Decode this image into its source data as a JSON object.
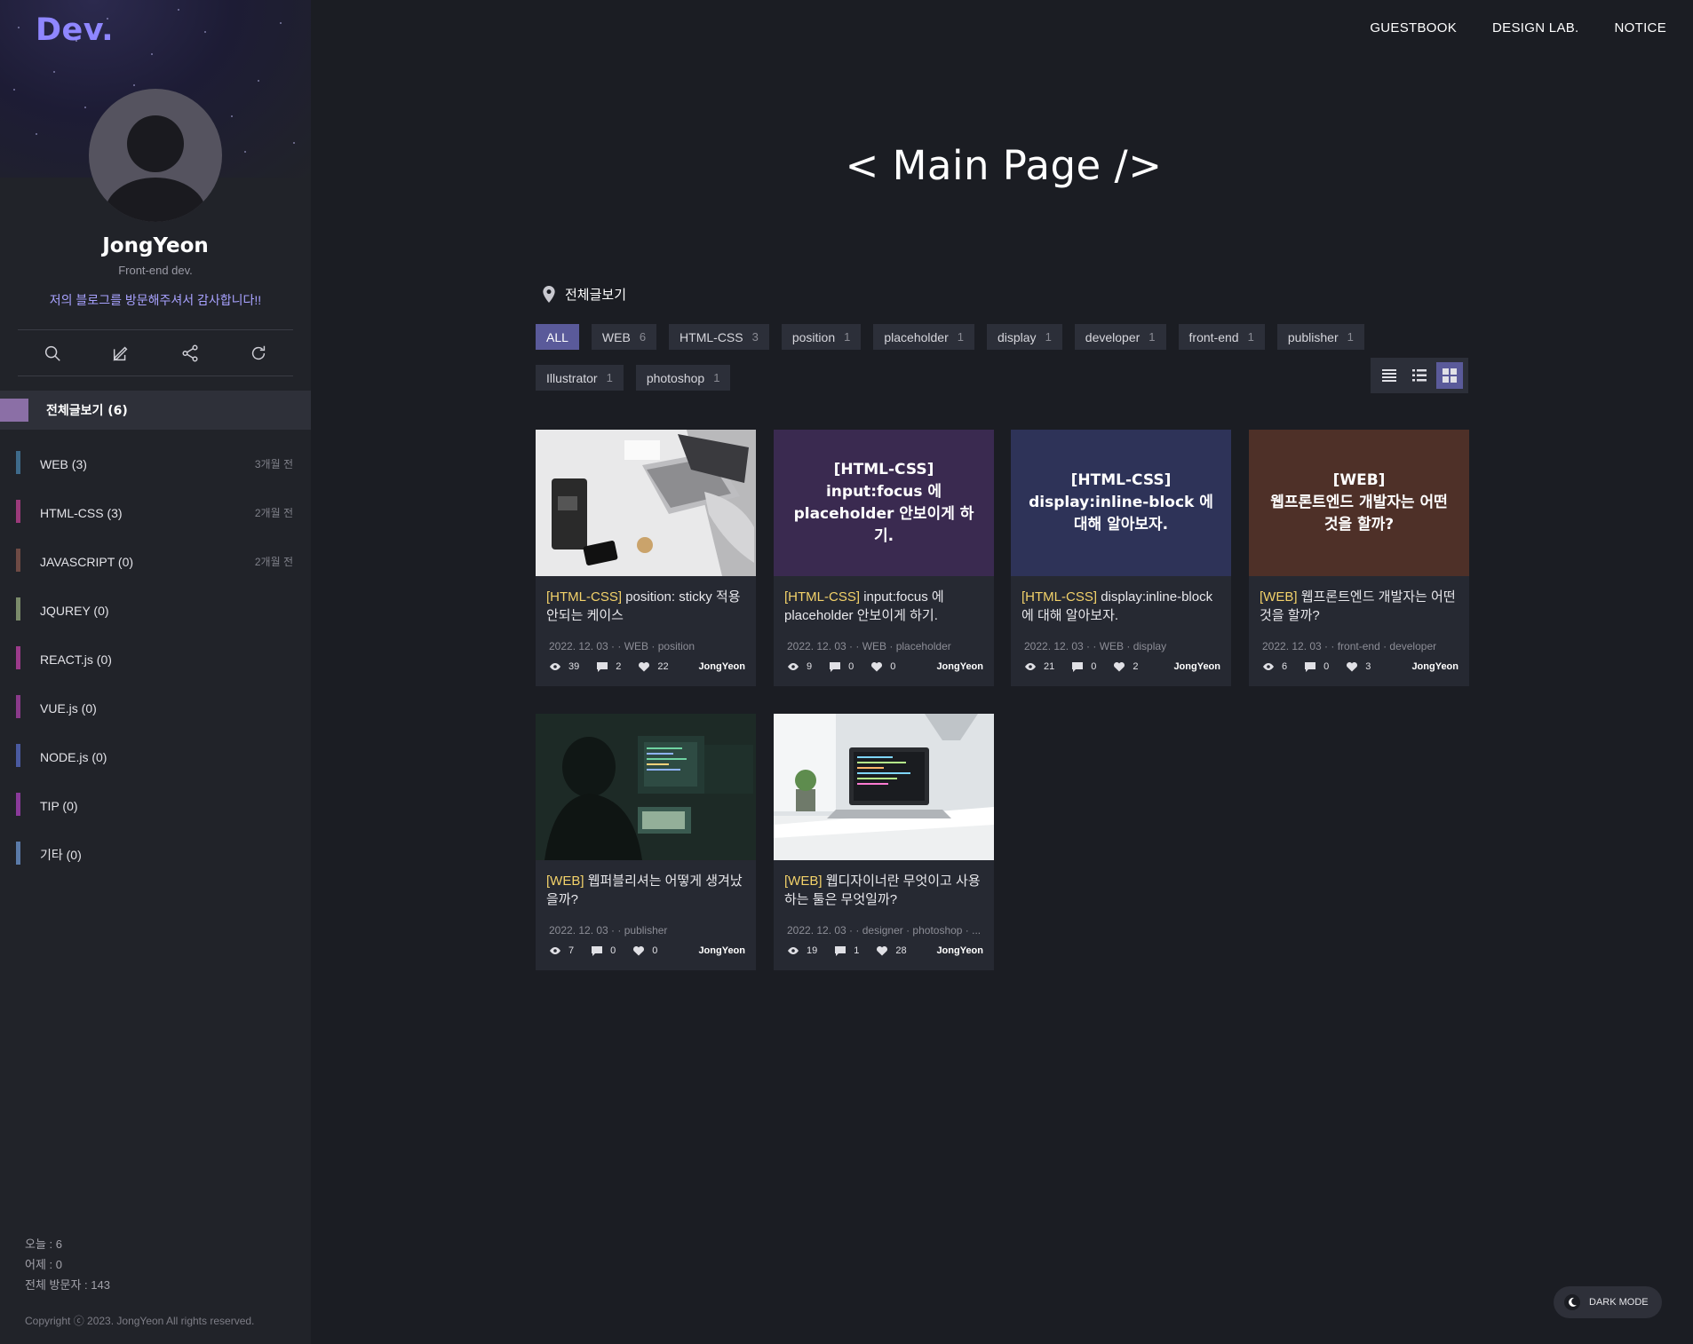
{
  "sidebar": {
    "logo": "Dev.",
    "profile": {
      "name": "JongYeon",
      "role": "Front-end dev.",
      "welcome": "저의 블로그를 방문해주셔서 감사합니다!!"
    },
    "tools": [
      "search-icon",
      "edit-icon",
      "share-icon",
      "refresh-icon"
    ],
    "all_label": "전체글보기 (6)",
    "categories": [
      {
        "label": "WEB (3)",
        "time": "3개월 전",
        "color": "#3e6a8a"
      },
      {
        "label": "HTML-CSS (3)",
        "time": "2개월 전",
        "color": "#9b3a7a"
      },
      {
        "label": "JAVASCRIPT (0)",
        "time": "2개월 전",
        "color": "#6e4a44"
      },
      {
        "label": "JQUREY (0)",
        "time": "",
        "color": "#7a8a6a"
      },
      {
        "label": "REACT.js (0)",
        "time": "",
        "color": "#9b3a8a"
      },
      {
        "label": "VUE.js (0)",
        "time": "",
        "color": "#8a3a8a"
      },
      {
        "label": "NODE.js (0)",
        "time": "",
        "color": "#4a5aa0"
      },
      {
        "label": "TIP (0)",
        "time": "",
        "color": "#8a3a9a"
      },
      {
        "label": "기타 (0)",
        "time": "",
        "color": "#5a7aa8"
      }
    ],
    "stats": {
      "today": "오늘 : 6",
      "yesterday": "어제 : 0",
      "total": "전체 방문자 : 143"
    },
    "copyright": "Copyright ⓒ 2023. JongYeon All rights reserved."
  },
  "nav": {
    "items": [
      "GUESTBOOK",
      "DESIGN LAB.",
      "NOTICE"
    ]
  },
  "main": {
    "title": "< Main Page />",
    "breadcrumb": "전체글보기",
    "tags": [
      {
        "label": "ALL",
        "count": "",
        "active": true
      },
      {
        "label": "WEB",
        "count": "6"
      },
      {
        "label": "HTML-CSS",
        "count": "3"
      },
      {
        "label": "position",
        "count": "1"
      },
      {
        "label": "placeholder",
        "count": "1"
      },
      {
        "label": "display",
        "count": "1"
      },
      {
        "label": "developer",
        "count": "1"
      },
      {
        "label": "front-end",
        "count": "1"
      },
      {
        "label": "publisher",
        "count": "1"
      },
      {
        "label": "Illustrator",
        "count": "1"
      },
      {
        "label": "photoshop",
        "count": "1"
      }
    ],
    "view_modes": [
      "list-view-icon",
      "compact-list-icon",
      "grid-view-icon"
    ],
    "active_view": "grid-view-icon"
  },
  "posts": [
    {
      "thumb_type": "photo",
      "thumb_text": "",
      "thumb_bg": "#d8d8d8",
      "cat": "[HTML-CSS]",
      "title": "position: sticky 적용안되는 케이스",
      "meta": "2022. 12. 03 · · WEB · position",
      "views": "39",
      "comments": "2",
      "likes": "22",
      "author": "JongYeon"
    },
    {
      "thumb_type": "text",
      "thumb_text": "[HTML-CSS]\ninput:focus 에 placeholder 안보이게 하기.",
      "thumb_bg": "#3a2a50",
      "cat": "[HTML-CSS]",
      "title": "input:focus 에 placeholder 안보이게 하기.",
      "meta": "2022. 12. 03 · · WEB · placeholder",
      "views": "9",
      "comments": "0",
      "likes": "0",
      "author": "JongYeon"
    },
    {
      "thumb_type": "text",
      "thumb_text": "[HTML-CSS]\ndisplay:inline-block 에 대해 알아보자.",
      "thumb_bg": "#2e3358",
      "cat": "[HTML-CSS]",
      "title": "display:inline-block 에 대해 알아보자.",
      "meta": "2022. 12. 03 · · WEB · display",
      "views": "21",
      "comments": "0",
      "likes": "2",
      "author": "JongYeon"
    },
    {
      "thumb_type": "text",
      "thumb_text": "[WEB]\n웹프론트엔드 개발자는 어떤 것을 할까?",
      "thumb_bg": "#4e3028",
      "cat": "[WEB]",
      "title": "웹프론트엔드 개발자는 어떤 것을 할까?",
      "meta": "2022. 12. 03 · · front-end · developer",
      "views": "6",
      "comments": "0",
      "likes": "3",
      "author": "JongYeon"
    },
    {
      "thumb_type": "photo-dark",
      "thumb_text": "",
      "thumb_bg": "#1d2a26",
      "cat": "[WEB]",
      "title": "웹퍼블리셔는 어떻게 생겨났을까?",
      "meta": "2022. 12. 03 · · publisher",
      "views": "7",
      "comments": "0",
      "likes": "0",
      "author": "JongYeon"
    },
    {
      "thumb_type": "photo-laptop",
      "thumb_text": "",
      "thumb_bg": "#cfd4d8",
      "cat": "[WEB]",
      "title": "웹디자이너란 무엇이고 사용하는 툴은 무엇일까?",
      "meta": "2022. 12. 03 · · designer · photoshop · ...",
      "views": "19",
      "comments": "1",
      "likes": "28",
      "author": "JongYeon"
    }
  ],
  "dark_mode": {
    "label": "DARK MODE"
  }
}
